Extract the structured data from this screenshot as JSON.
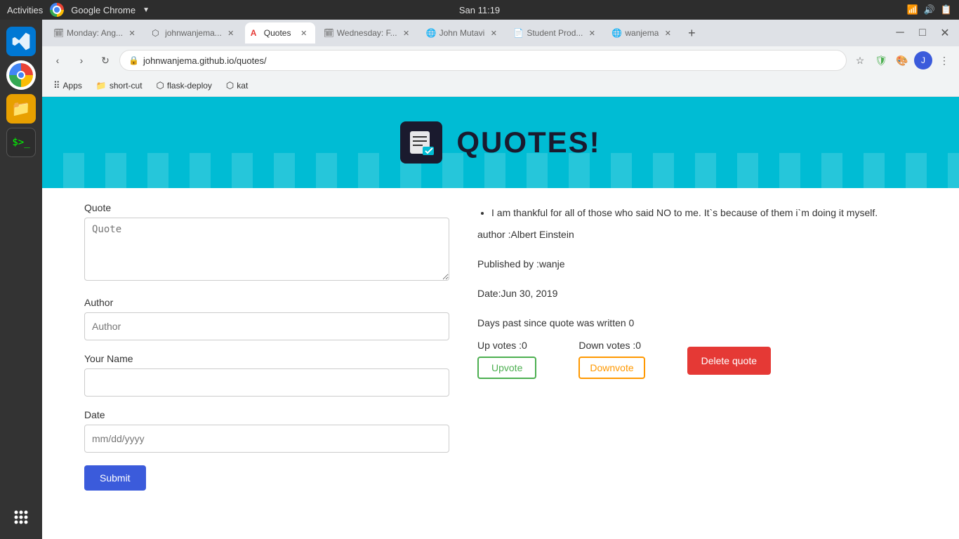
{
  "os": {
    "topbar": {
      "left_label": "Activities",
      "app_name": "Google Chrome",
      "time": "San 11:19"
    }
  },
  "browser": {
    "tabs": [
      {
        "id": "tab1",
        "label": "Monday: Ang...",
        "favicon": "🗓",
        "active": false
      },
      {
        "id": "tab2",
        "label": "johnwanjema...",
        "favicon": "⬡",
        "active": false
      },
      {
        "id": "tab3",
        "label": "Quotes",
        "favicon": "A",
        "active": true
      },
      {
        "id": "tab4",
        "label": "Wednesday: F...",
        "favicon": "🗓",
        "active": false
      },
      {
        "id": "tab5",
        "label": "John Mutavi",
        "favicon": "🌐",
        "active": false
      },
      {
        "id": "tab6",
        "label": "Student Prod...",
        "favicon": "📄",
        "active": false
      },
      {
        "id": "tab7",
        "label": "wanjema",
        "favicon": "🌐",
        "active": false
      }
    ],
    "address": "johnwanjema.github.io/quotes/",
    "bookmarks": [
      {
        "id": "bk1",
        "label": "Apps",
        "icon": "grid"
      },
      {
        "id": "bk2",
        "label": "short-cut",
        "icon": "folder"
      },
      {
        "id": "bk3",
        "label": "flask-deploy",
        "icon": "github"
      },
      {
        "id": "bk4",
        "label": "kat",
        "icon": "github"
      }
    ]
  },
  "page": {
    "hero": {
      "title": "QUOTES!"
    },
    "form": {
      "quote_label": "Quote",
      "quote_placeholder": "Quote",
      "author_label": "Author",
      "author_placeholder": "Author",
      "your_name_label": "Your Name",
      "your_name_placeholder": "",
      "date_label": "Date",
      "date_placeholder": "mm/dd/yyyy",
      "submit_label": "Submit"
    },
    "quote_display": {
      "quote_text": "I am thankful for all of those who said NO to me. It`s because of them i`m doing it myself.",
      "author_line": "author :Albert Einstein",
      "published_by": "Published by :wanje",
      "date_line": "Date:Jun 30, 2019",
      "days_past": "Days past since quote was written 0",
      "upvotes_label": "Up votes :0",
      "downvotes_label": "Down votes :0",
      "upvote_btn": "Upvote",
      "downvote_btn": "Downvote",
      "delete_btn": "Delete quote"
    }
  }
}
